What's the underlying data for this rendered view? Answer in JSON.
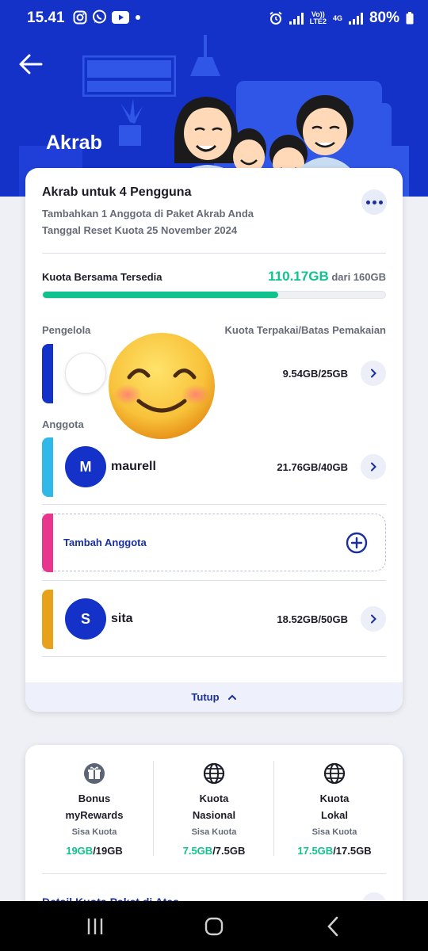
{
  "status_bar": {
    "time": "15.41",
    "net_top": "Vo))",
    "net_bottom": "LTE2",
    "net_type": "4G",
    "battery": "80%"
  },
  "header": {
    "title": "Akrab"
  },
  "plan": {
    "title": "Akrab untuk 4 Pengguna",
    "subtitle": "Tambahkan 1 Anggota di Paket Akrab Anda",
    "reset_date": "Tanggal Reset Kuota 25 November 2024",
    "quota_label": "Kuota Bersama Tersedia",
    "quota_available": "110.17GB",
    "quota_total": "dari 160GB",
    "quota_fraction": 0.6886,
    "col_manager": "Pengelola",
    "col_usage": "Kuota Terpakai/Batas Pemakaian",
    "members_label": "Anggota",
    "manager": {
      "initial": "",
      "name": "",
      "usage": "9.54GB/25GB",
      "color": "#1431c8"
    },
    "members": [
      {
        "initial": "M",
        "name": "maurell",
        "usage": "21.76GB/40GB",
        "color": "#2fb8e8"
      },
      {
        "initial": "S",
        "name": "sita",
        "usage": "18.52GB/50GB",
        "color": "#e8a11a"
      }
    ],
    "add_member_label": "Tambah Anggota",
    "add_member_color": "#e8368f",
    "collapse_label": "Tutup"
  },
  "quotas": [
    {
      "title_line1": "Bonus",
      "title_line2": "myRewards",
      "sisa_label": "Sisa Kuota",
      "remaining": "19GB",
      "total": "/19GB",
      "icon": "gift-icon"
    },
    {
      "title_line1": "Kuota",
      "title_line2": "Nasional",
      "sisa_label": "Sisa Kuota",
      "remaining": "7.5GB",
      "total": "/7.5GB",
      "icon": "globe-icon"
    },
    {
      "title_line1": "Kuota",
      "title_line2": "Lokal",
      "sisa_label": "Sisa Kuota",
      "remaining": "17.5GB",
      "total": "/17.5GB",
      "icon": "globe-icon"
    }
  ],
  "detail_link": "Detail Kuota Paket di Atas",
  "colors": {
    "brand_blue": "#1431c8",
    "accent_green": "#10c38e",
    "link_blue": "#1a2f9e"
  }
}
